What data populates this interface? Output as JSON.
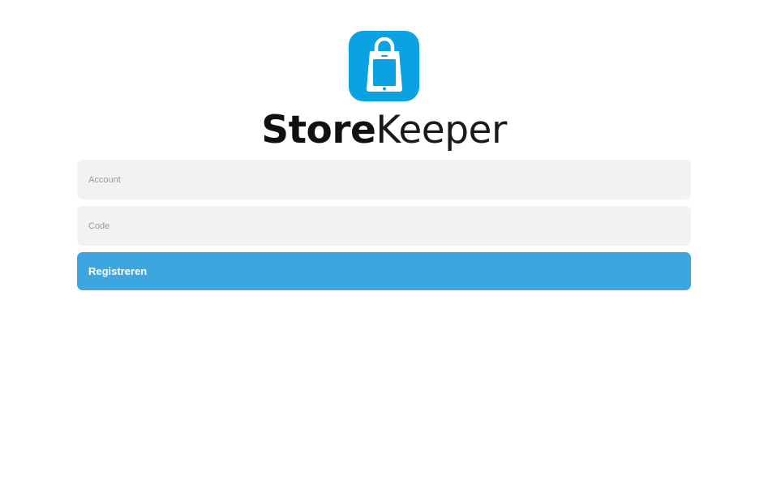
{
  "app": {
    "brand_bold": "Store",
    "brand_light": "Keeper",
    "icon": "shopping-bag-tablet-icon",
    "icon_color": "#0ba2e2"
  },
  "form": {
    "account_placeholder": "Account",
    "account_value": "",
    "code_placeholder": "Code",
    "code_value": "",
    "register_label": "Registreren",
    "button_color": "#3da6e0",
    "field_bg_color": "#f2f2f2"
  }
}
